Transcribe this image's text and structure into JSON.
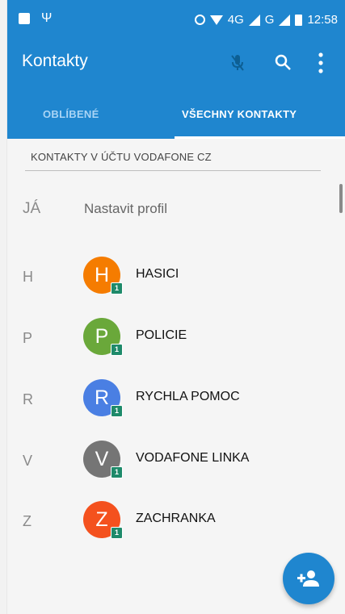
{
  "status_bar": {
    "network_text": "4G",
    "network_text_2": "G",
    "time": "12:58"
  },
  "app_bar": {
    "title": "Kontakty"
  },
  "tabs": [
    {
      "label": "OBLÍBENÉ",
      "selected": false
    },
    {
      "label": "VŠECHNY KONTAKTY",
      "selected": true
    }
  ],
  "account_header": "KONTAKTY V ÚČTU VODAFONE CZ",
  "me": {
    "letter": "JÁ",
    "action": "Nastavit profil"
  },
  "contacts": [
    {
      "section": "H",
      "initial": "H",
      "name": "HASICI",
      "color": "#f57c00",
      "badge": "1"
    },
    {
      "section": "P",
      "initial": "P",
      "name": "POLICIE",
      "color": "#6aa83a",
      "badge": "1"
    },
    {
      "section": "R",
      "initial": "R",
      "name": "RYCHLA POMOC",
      "color": "#4a7fe3",
      "badge": "1"
    },
    {
      "section": "V",
      "initial": "V",
      "name": "VODAFONE LINKA",
      "color": "#757575",
      "badge": "1"
    },
    {
      "section": "Z",
      "initial": "Z",
      "name": "ZACHRANKA",
      "color": "#f4511e",
      "badge": "1"
    }
  ],
  "colors": {
    "primary": "#1f86cf",
    "badge": "#1e8a6a"
  },
  "icons": {
    "mic": "mic-off-icon",
    "search": "search-icon",
    "more": "more-vert-icon",
    "fab": "add-contact-icon"
  }
}
